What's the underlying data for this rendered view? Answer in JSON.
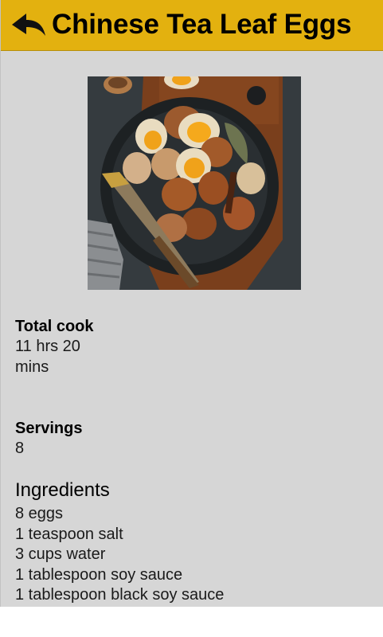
{
  "header": {
    "title": "Chinese Tea Leaf Eggs",
    "back_icon": "reply-arrow-icon"
  },
  "recipe": {
    "image_alt": "Tea leaf eggs in a dark bowl",
    "total_cook_label": "Total cook",
    "total_cook_value": "11 hrs 20 mins",
    "servings_label": "Servings",
    "servings_value": "8",
    "ingredients_heading": "Ingredients",
    "ingredients": [
      "8 eggs",
      "1 teaspoon salt",
      "3 cups water",
      "1 tablespoon soy sauce",
      "1 tablespoon black soy sauce"
    ]
  },
  "colors": {
    "header_bg": "#e3b10f",
    "page_bg": "#d6d6d6"
  }
}
